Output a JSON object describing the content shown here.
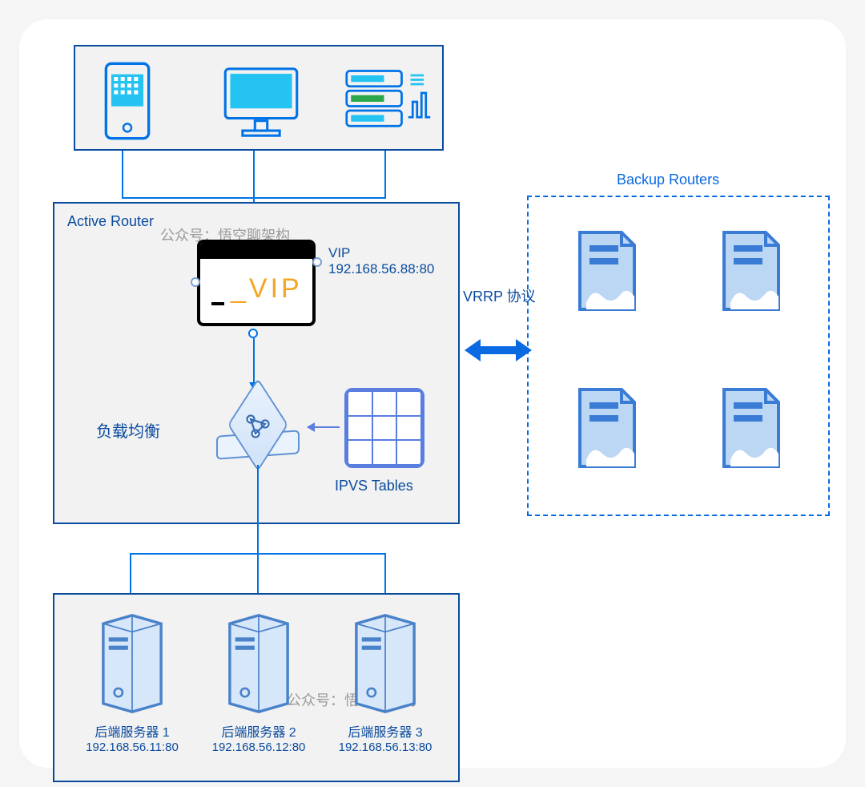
{
  "active_router": {
    "title": "Active Router",
    "vip_tag": "_VIP",
    "vip_label1": "VIP",
    "vip_label2": "192.168.56.88:80",
    "lb_label": "负载均衡",
    "ipvs_label": "IPVS Tables",
    "watermark": "公众号：悟空聊架构"
  },
  "vrrp": {
    "label": "VRRP 协议"
  },
  "backup": {
    "title": "Backup Routers"
  },
  "backend": {
    "watermark": "公众号：悟空聊架构",
    "servers": [
      {
        "label": "后端服务器 1",
        "ip": "192.168.56.11:80"
      },
      {
        "label": "后端服务器 2",
        "ip": "192.168.56.12:80"
      },
      {
        "label": "后端服务器 3",
        "ip": "192.168.56.13:80"
      }
    ]
  }
}
